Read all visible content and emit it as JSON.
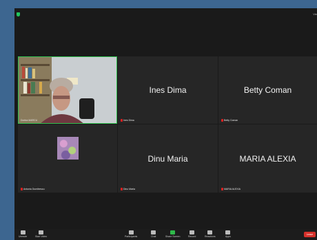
{
  "header": {
    "view_label": "Vie"
  },
  "participants": [
    {
      "display_name": "",
      "label": "Dorina MARCU",
      "muted": false,
      "has_video": true
    },
    {
      "display_name": "Ines Dima",
      "label": "Ines Dima",
      "muted": true,
      "has_video": false
    },
    {
      "display_name": "Betty Coman",
      "label": "Betty Coman",
      "muted": true,
      "has_video": false
    },
    {
      "display_name": "",
      "label": "Antonia Dumitrescu",
      "muted": true,
      "has_video": false,
      "has_thumbnail": true
    },
    {
      "display_name": "Dinu Maria",
      "label": "Dinu Maria",
      "muted": true,
      "has_video": false
    },
    {
      "display_name": "MARIA ALEXIA",
      "label": "MARIA ALEXIA",
      "muted": true,
      "has_video": false
    }
  ],
  "toolbar": {
    "items": [
      {
        "label": "Unmute",
        "icon": "microphone-icon"
      },
      {
        "label": "Start Video",
        "icon": "video-camera-icon"
      },
      {
        "label": "Participants",
        "icon": "participants-icon"
      },
      {
        "label": "Chat",
        "icon": "chat-icon"
      },
      {
        "label": "Share Screen",
        "icon": "share-screen-icon"
      },
      {
        "label": "Record",
        "icon": "record-icon"
      },
      {
        "label": "Reactions",
        "icon": "reactions-icon"
      },
      {
        "label": "Apps",
        "icon": "apps-icon"
      }
    ],
    "leave_label": "Leave"
  },
  "colors": {
    "active_border": "#30c24f",
    "mute": "#e02020",
    "leave": "#d6312b",
    "share": "#2fb94a"
  }
}
